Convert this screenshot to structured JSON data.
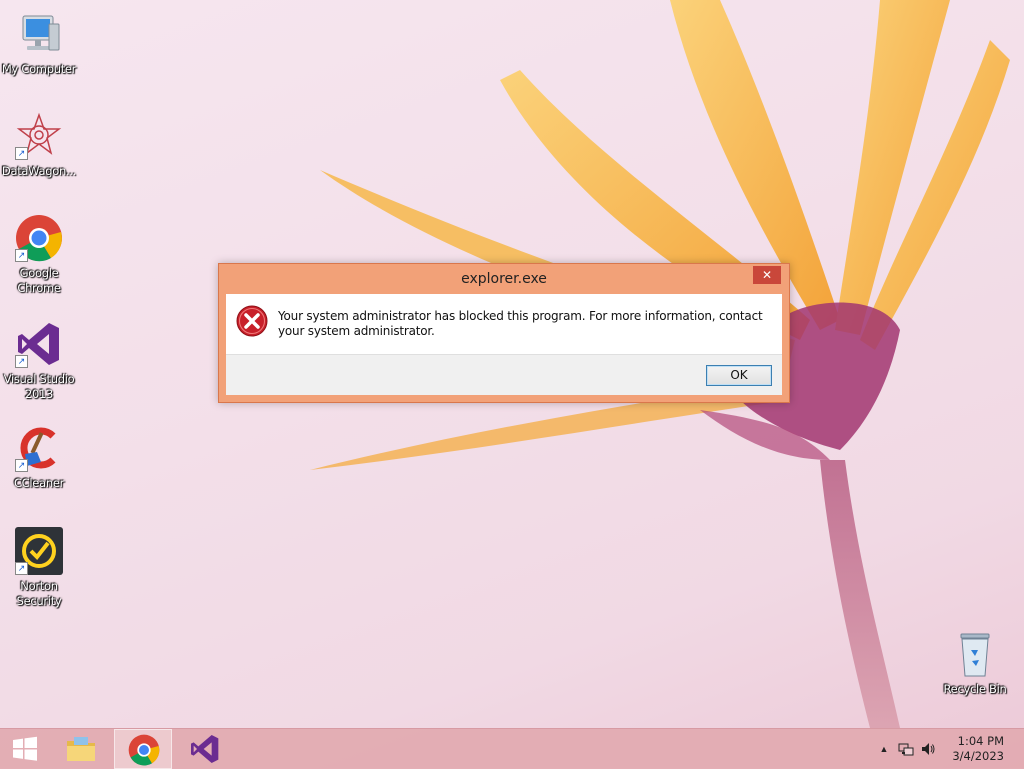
{
  "desktop": {
    "icons": [
      {
        "label": "My Computer"
      },
      {
        "label": "DataWagon..."
      },
      {
        "label": "Google Chrome"
      },
      {
        "label": "Visual Studio 2013"
      },
      {
        "label": "CCleaner"
      },
      {
        "label": "Norton Security"
      }
    ],
    "recycle_bin": {
      "label": "Recycle Bin"
    }
  },
  "dialog": {
    "title": "explorer.exe",
    "close_glyph": "✕",
    "message": "Your system administrator has blocked this program. For more information, contact your system administrator.",
    "ok_label": "OK",
    "icon": "error-icon"
  },
  "taskbar": {
    "items": [
      "start-button",
      "file-explorer",
      "google-chrome",
      "visual-studio"
    ],
    "active_item": "google-chrome",
    "tray": {
      "show_hidden_glyph": "▲",
      "time": "1:04 PM",
      "date": "3/4/2023"
    }
  },
  "colors": {
    "dialog_frame": "#f2a178",
    "close_button": "#c9473a",
    "taskbar": "#e2aab0"
  }
}
